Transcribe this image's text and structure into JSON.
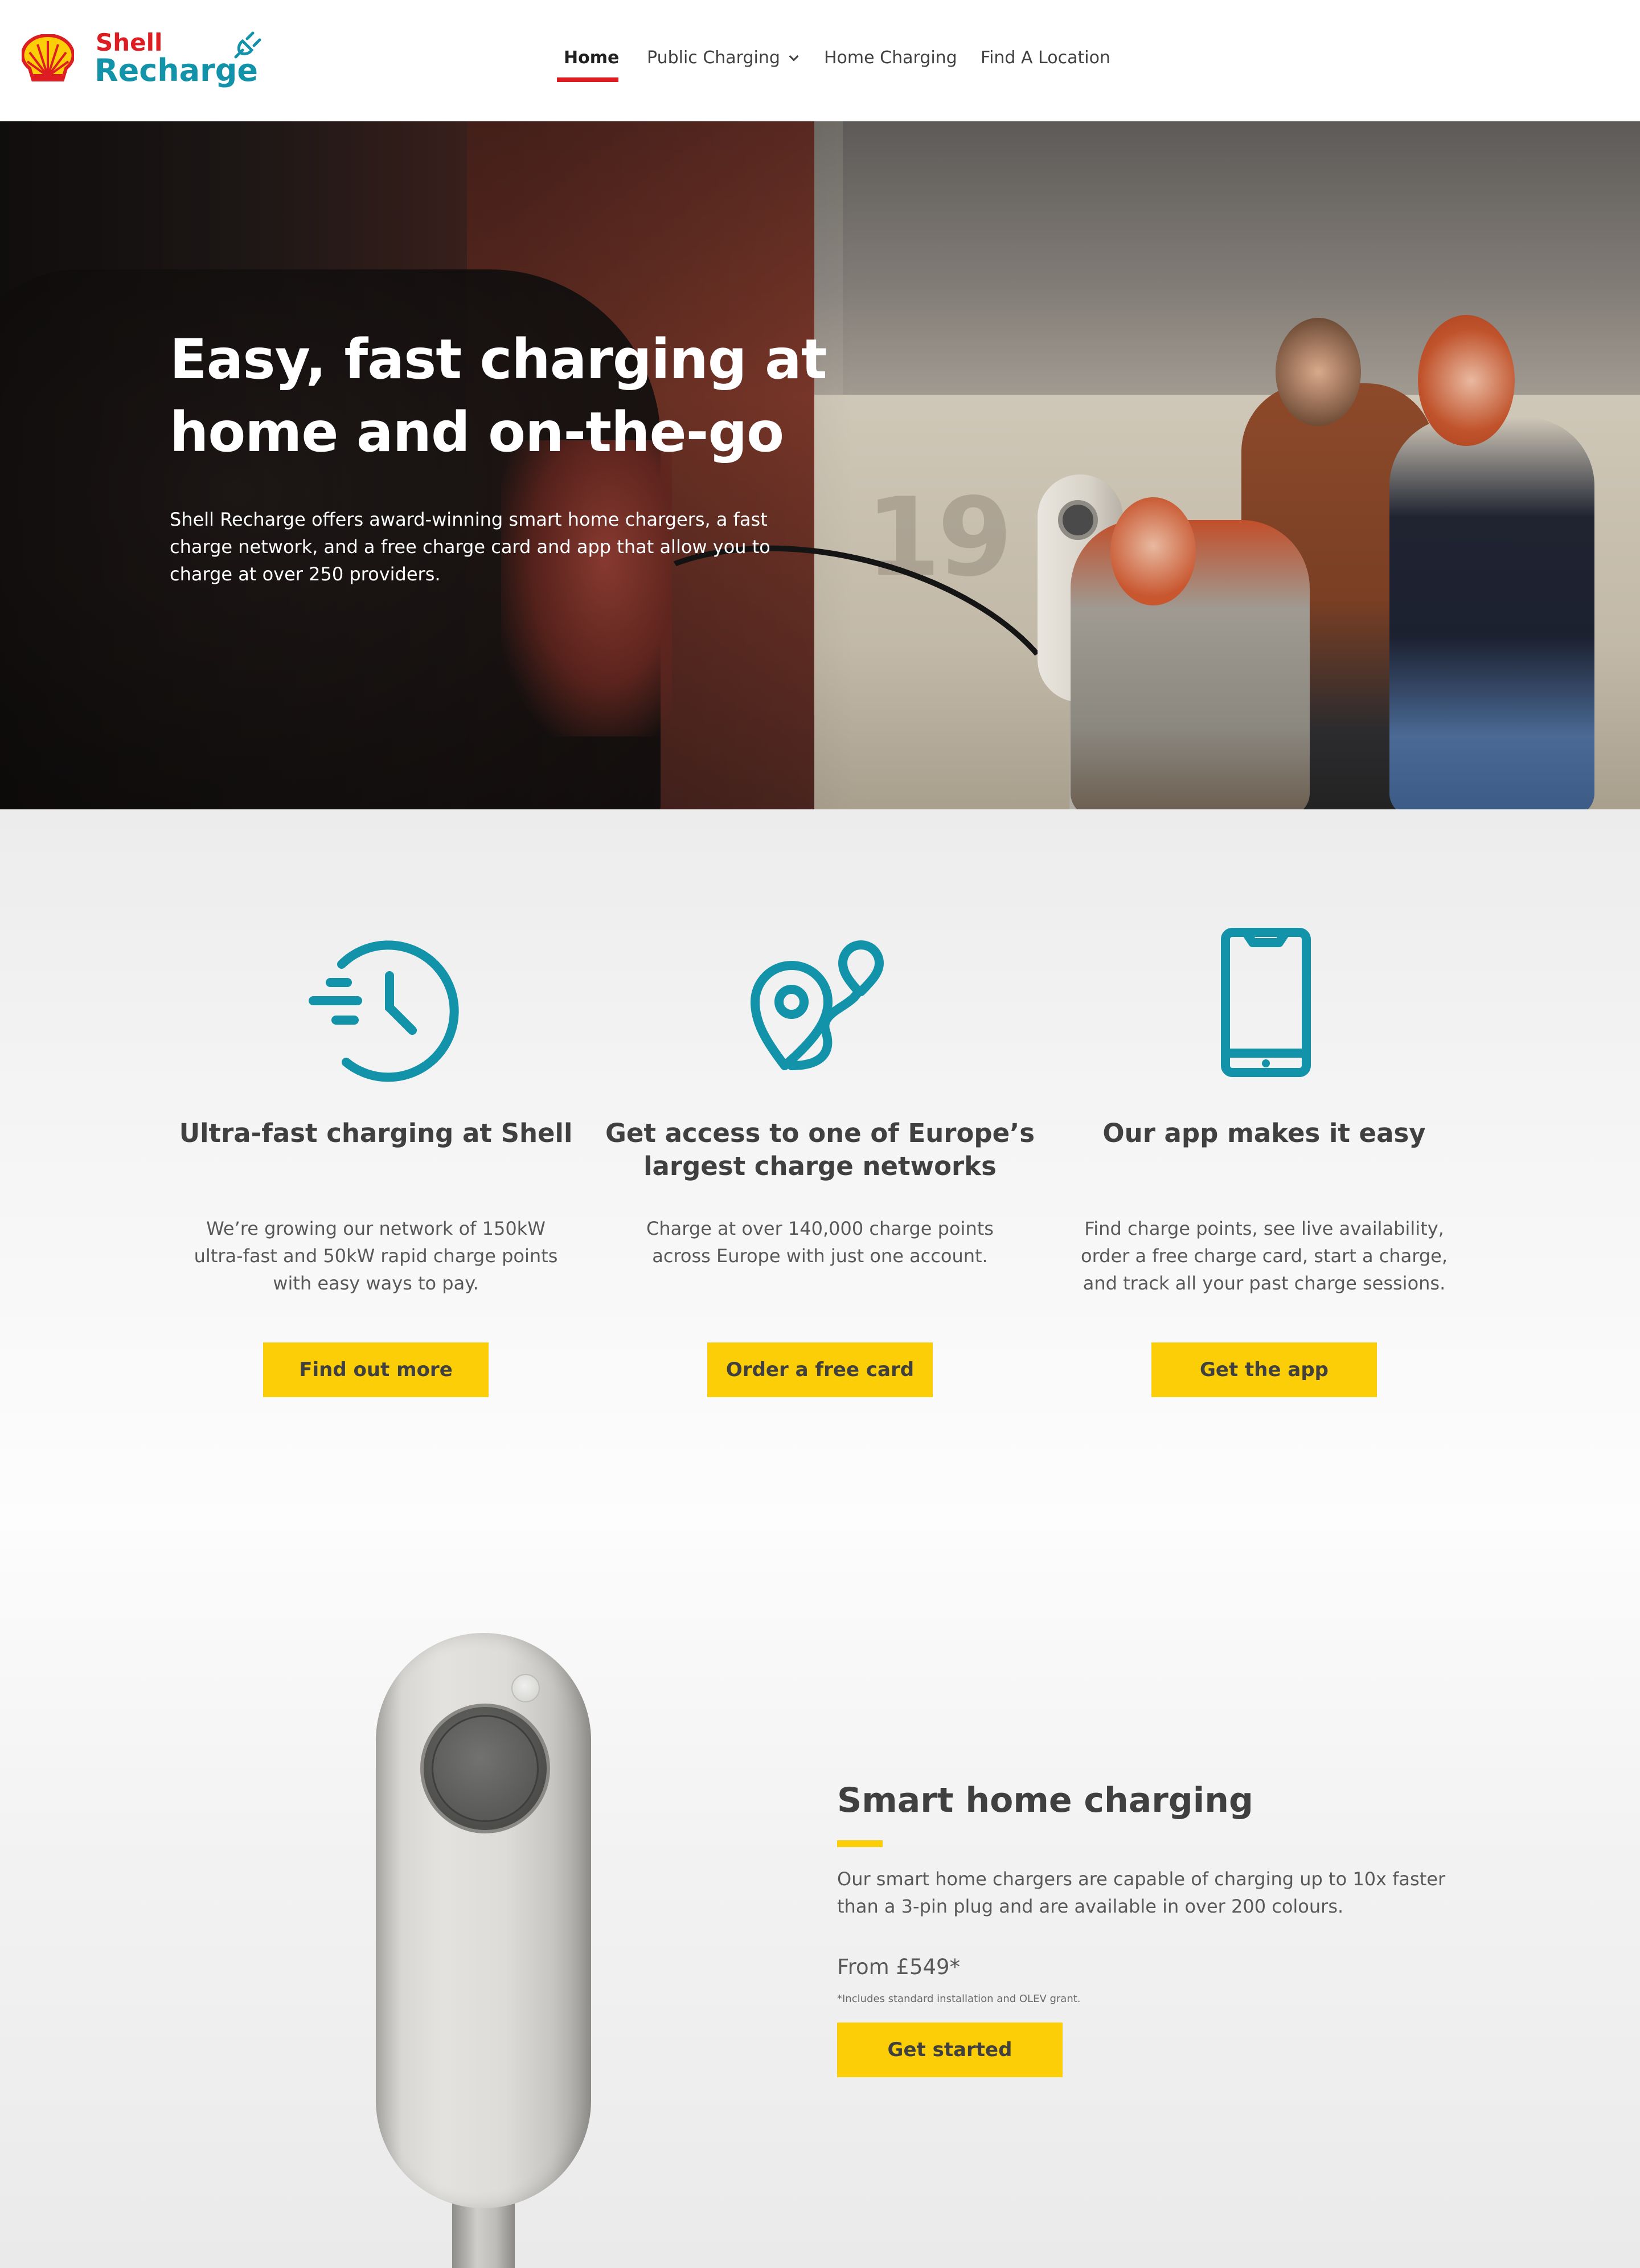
{
  "header": {
    "logo": {
      "brand": "Shell",
      "name": "Recharge",
      "icon": "shell-pecten-icon",
      "plug_icon": "plug-icon"
    },
    "nav": [
      {
        "label": "Home",
        "active": true
      },
      {
        "label": "Public Charging",
        "active": false,
        "has_dropdown": true
      },
      {
        "label": "Home Charging",
        "active": false
      },
      {
        "label": "Find A Location",
        "active": false
      }
    ]
  },
  "hero": {
    "title": "Easy, fast charging at home and on-the-go",
    "text": "Shell Recharge offers award-winning smart home chargers, a fast charge network, and a free charge card and app that allow you to charge at over 250 providers."
  },
  "features": [
    {
      "icon": "clock-fast-icon",
      "title": "Ultra-fast charging at Shell",
      "text": "We’re growing our network of 150kW ultra-fast and 50kW rapid charge points with easy ways to pay.",
      "button": "Find out more"
    },
    {
      "icon": "map-route-pin-icon",
      "title": "Get access to one of Europe’s largest charge networks",
      "text": "Charge at over 140,000 charge points across Europe with just one account.",
      "button": "Order a free card"
    },
    {
      "icon": "smartphone-icon",
      "title": "Our app makes it easy",
      "text": "Find charge points, see live availability, order a free charge card, start a charge, and track all your past charge sessions.",
      "button": "Get the app"
    }
  ],
  "smart": {
    "title": "Smart home charging",
    "text": "Our smart home chargers are capable of charging up to 10x faster than a 3-pin plug and are available in over 200 colours.",
    "price": "From £549*",
    "footnote": "*Includes standard installation and OLEV grant.",
    "button": "Get started"
  },
  "colors": {
    "accent_red": "#dd1d21",
    "accent_teal": "#1393a9",
    "button_yellow": "#fbce07",
    "text_dark": "#404040"
  }
}
